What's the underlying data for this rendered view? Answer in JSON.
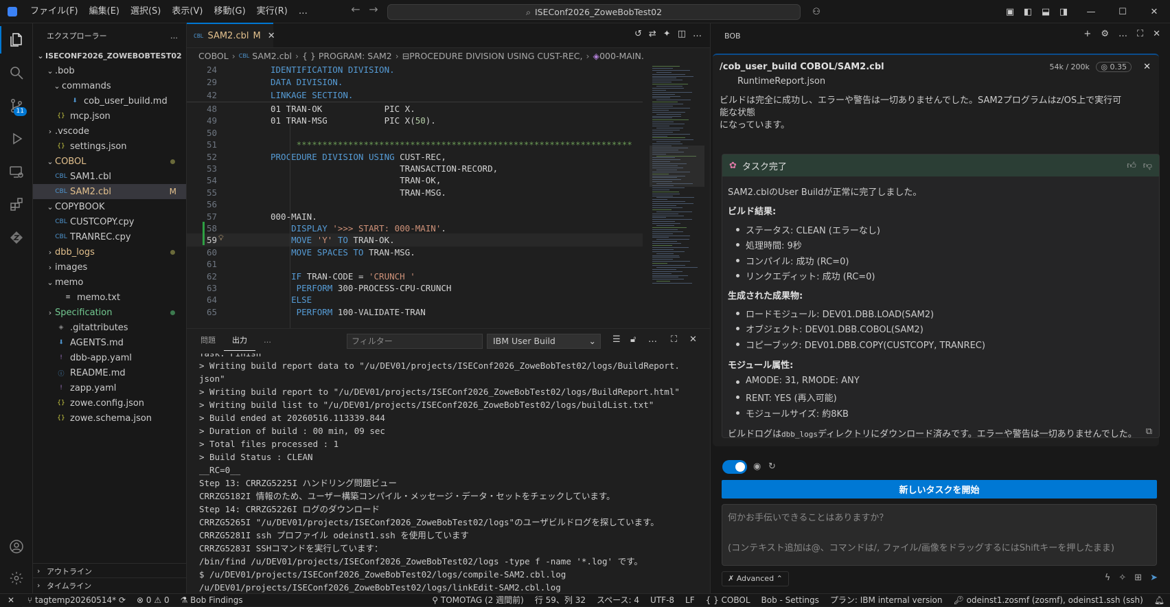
{
  "window": {
    "search_text": "ISEConf2026_ZoweBobTest02"
  },
  "menu": [
    "ファイル(F)",
    "編集(E)",
    "選択(S)",
    "表示(V)",
    "移動(G)",
    "実行(R)",
    "…"
  ],
  "activity_bar": {
    "scm_badge": "11"
  },
  "sidebar": {
    "title": "エクスプローラー",
    "more": "…",
    "root": "ISECONF2026_ZOWEBOBTEST02",
    "items": [
      {
        "label": ".bob",
        "chev": "⌄",
        "indent": 1,
        "icon": "",
        "color": "#cccccc"
      },
      {
        "label": "commands",
        "chev": "⌄",
        "indent": 2,
        "icon": "",
        "color": "#cccccc"
      },
      {
        "label": "cob_user_build.md",
        "chev": "",
        "indent": 3,
        "icon": "⬇",
        "icon_color": "#4e94ce",
        "color": "#cccccc"
      },
      {
        "label": "mcp.json",
        "chev": "",
        "indent": 1,
        "icon": "{}",
        "icon_color": "#cbcb41",
        "color": "#cccccc"
      },
      {
        "label": ".vscode",
        "chev": "›",
        "indent": 1,
        "icon": "",
        "color": "#cccccc"
      },
      {
        "label": "settings.json",
        "chev": "",
        "indent": 1,
        "icon": "{}",
        "icon_color": "#cbcb41",
        "color": "#cccccc"
      },
      {
        "label": "COBOL",
        "chev": "⌄",
        "indent": 1,
        "icon": "",
        "color": "#e2c08d",
        "dot": "#6a6a3a"
      },
      {
        "label": "SAM1.cbl",
        "chev": "",
        "indent": 1,
        "icon": "CBL",
        "icon_color": "#4e94ce",
        "color": "#cccccc"
      },
      {
        "label": "SAM2.cbl",
        "chev": "",
        "indent": 1,
        "icon": "CBL",
        "icon_color": "#4e94ce",
        "color": "#e2c08d",
        "mark": "M",
        "selected": true
      },
      {
        "label": "COPYBOOK",
        "chev": "⌄",
        "indent": 1,
        "icon": "",
        "color": "#cccccc"
      },
      {
        "label": "CUSTCOPY.cpy",
        "chev": "",
        "indent": 1,
        "icon": "CBL",
        "icon_color": "#4e94ce",
        "color": "#cccccc"
      },
      {
        "label": "TRANREC.cpy",
        "chev": "",
        "indent": 1,
        "icon": "CBL",
        "icon_color": "#4e94ce",
        "color": "#cccccc"
      },
      {
        "label": "dbb_logs",
        "chev": "›",
        "indent": 1,
        "icon": "",
        "color": "#e2c08d",
        "dot": "#6a6a3a"
      },
      {
        "label": "images",
        "chev": "›",
        "indent": 1,
        "icon": "",
        "color": "#cccccc"
      },
      {
        "label": "memo",
        "chev": "⌄",
        "indent": 1,
        "icon": "",
        "color": "#cccccc"
      },
      {
        "label": "memo.txt",
        "chev": "",
        "indent": 2,
        "icon": "≡",
        "icon_color": "#cccccc",
        "color": "#cccccc"
      },
      {
        "label": "Specification",
        "chev": "›",
        "indent": 1,
        "icon": "",
        "color": "#73c991",
        "dot": "#3c7a4e"
      },
      {
        "label": ".gitattributes",
        "chev": "",
        "indent": 1,
        "icon": "◈",
        "icon_color": "#8a8a8a",
        "color": "#cccccc"
      },
      {
        "label": "AGENTS.md",
        "chev": "",
        "indent": 1,
        "icon": "⬇",
        "icon_color": "#4e94ce",
        "color": "#cccccc"
      },
      {
        "label": "dbb-app.yaml",
        "chev": "",
        "indent": 1,
        "icon": "!",
        "icon_color": "#a074c4",
        "color": "#cccccc"
      },
      {
        "label": "README.md",
        "chev": "",
        "indent": 1,
        "icon": "ⓘ",
        "icon_color": "#4e94ce",
        "color": "#cccccc"
      },
      {
        "label": "zapp.yaml",
        "chev": "",
        "indent": 1,
        "icon": "!",
        "icon_color": "#a074c4",
        "color": "#cccccc"
      },
      {
        "label": "zowe.config.json",
        "chev": "",
        "indent": 1,
        "icon": "{}",
        "icon_color": "#cbcb41",
        "color": "#cccccc"
      },
      {
        "label": "zowe.schema.json",
        "chev": "",
        "indent": 1,
        "icon": "{}",
        "icon_color": "#cbcb41",
        "color": "#cccccc"
      }
    ],
    "outline": "アウトライン",
    "timeline": "タイムライン"
  },
  "editor": {
    "tab": {
      "badge": "CBL",
      "name": "SAM2.cbl",
      "modified": "M",
      "close": "✕"
    },
    "breadcrumb": [
      "COBOL",
      "SAM2.cbl",
      "{ } PROGRAM: SAM2",
      "PROCEDURE DIVISION USING CUST-REC,",
      "000-MAIN."
    ],
    "sticky_lines": [
      {
        "n": "24",
        "parts": [
          {
            "t": "IDENTIFICATION DIVISION.",
            "c": "kw"
          }
        ]
      },
      {
        "n": "29",
        "parts": [
          {
            "t": "DATA DIVISION.",
            "c": "kw"
          }
        ]
      },
      {
        "n": "42",
        "parts": [
          {
            "t": "LINKAGE SECTION.",
            "c": "kw"
          }
        ]
      }
    ],
    "lines": [
      {
        "n": "48",
        "parts": [
          {
            "t": "01 TRAN-OK            PIC X.",
            "c": "id"
          }
        ]
      },
      {
        "n": "49",
        "parts": [
          {
            "t": "01 TRAN-MSG           PIC X(",
            "c": "id"
          },
          {
            "t": "50",
            "c": "num"
          },
          {
            "t": ").",
            "c": "id"
          }
        ]
      },
      {
        "n": "50",
        "parts": []
      },
      {
        "n": "51",
        "parts": [
          {
            "t": "*****************************************************************",
            "c": "cm"
          }
        ],
        "indent": "     "
      },
      {
        "n": "52",
        "parts": [
          {
            "t": "PROCEDURE DIVISION USING ",
            "c": "kw"
          },
          {
            "t": "CUST-REC,",
            "c": "id"
          }
        ]
      },
      {
        "n": "53",
        "parts": [
          {
            "t": "                         TRANSACTION-RECORD,",
            "c": "id"
          }
        ]
      },
      {
        "n": "54",
        "parts": [
          {
            "t": "                         TRAN-OK,",
            "c": "id"
          }
        ]
      },
      {
        "n": "55",
        "parts": [
          {
            "t": "                         TRAN-MSG.",
            "c": "id"
          }
        ]
      },
      {
        "n": "56",
        "parts": []
      },
      {
        "n": "57",
        "parts": [
          {
            "t": "000-MAIN.",
            "c": "id"
          }
        ]
      },
      {
        "n": "58",
        "parts": [
          {
            "t": "    DISPLAY ",
            "c": "kw"
          },
          {
            "t": "'>>> START: 000-MAIN'",
            "c": "str"
          },
          {
            "t": ".",
            "c": "id"
          }
        ]
      },
      {
        "n": "59",
        "parts": [
          {
            "t": "    MOVE ",
            "c": "kw"
          },
          {
            "t": "'Y'",
            "c": "str"
          },
          {
            "t": " TO ",
            "c": "kw"
          },
          {
            "t": "TRAN-OK.",
            "c": "id"
          }
        ],
        "current": true
      },
      {
        "n": "60",
        "parts": [
          {
            "t": "    MOVE SPACES TO ",
            "c": "kw"
          },
          {
            "t": "TRAN-MSG.",
            "c": "id"
          }
        ]
      },
      {
        "n": "61",
        "parts": []
      },
      {
        "n": "62",
        "parts": [
          {
            "t": "    IF ",
            "c": "kw"
          },
          {
            "t": "TRAN-CODE = ",
            "c": "id"
          },
          {
            "t": "'CRUNCH '",
            "c": "str"
          }
        ]
      },
      {
        "n": "63",
        "parts": [
          {
            "t": "     PERFORM ",
            "c": "kw"
          },
          {
            "t": "300-PROCESS-CPU-CRUNCH",
            "c": "id"
          }
        ]
      },
      {
        "n": "64",
        "parts": [
          {
            "t": "    ELSE",
            "c": "kw"
          }
        ]
      },
      {
        "n": "65",
        "parts": [
          {
            "t": "     PERFORM ",
            "c": "kw"
          },
          {
            "t": "100-VALIDATE-TRAN",
            "c": "id"
          }
        ]
      }
    ]
  },
  "panel": {
    "tab_problems": "問題",
    "tab_output": "出力",
    "more": "…",
    "filter_placeholder": "フィルター",
    "channel": "IBM User Build",
    "output_lines": [
      "Task: Finish",
      "> Writing build report data to \"/u/DEV01/projects/ISEConf2026_ZoweBobTest02/logs/BuildReport.",
      "json\"",
      "> Writing build report to \"/u/DEV01/projects/ISEConf2026_ZoweBobTest02/logs/BuildReport.html\"",
      "> Writing build list to \"/u/DEV01/projects/ISEConf2026_ZoweBobTest02/logs/buildList.txt\"",
      "> Build ended at 20260516.113339.844",
      "> Duration of build : 00 min, 09 sec",
      "> Total files processed : 1",
      "> Build Status : CLEAN",
      "__RC=0__",
      "Step 13: CRRZG5225I ハンドリング問題ビュー",
      "CRRZG5182I 情報のため、ユーザー構築コンパイル・メッセージ・データ・セットをチェックしています。",
      "Step 14: CRRZG5226I ログのダウンロード",
      "CRRZG5265I \"/u/DEV01/projects/ISEConf2026_ZoweBobTest02/logs\"のユーザビルドログを探しています。",
      "CRRZG5281I ssh プロファイル odeinst1.ssh を使用しています",
      "CRRZG5283I SSHコマンドを実行しています：",
      "/bin/find /u/DEV01/projects/ISEConf2026_ZoweBobTest02/logs -type f -name '*.log' です。",
      "$ /u/DEV01/projects/ISEConf2026_ZoweBobTest02/logs/compile-SAM2.cbl.log",
      "/u/DEV01/projects/ISEConf2026_ZoweBobTest02/logs/linkEdit-SAM2.cbl.log"
    ]
  },
  "bob": {
    "title": "BOB",
    "task_title": "/cob_user_build COBOL/SAM2.cbl",
    "tokens": "54k / 200k",
    "cost": "0.35",
    "partial_item": "RuntimeReport.json",
    "summary": "ビルドは完全に成功し、エラーや警告は一切ありませんでした。SAM2プログラムはz/OS上で実行可能な状態になっています。",
    "summary_line1": "ビルドは完全に成功し、エラーや警告は一切ありませんでした。SAM2プログラムはz/OS上で実行可能な状態",
    "summary_line2": "になっています。",
    "task_complete": "タスク完了",
    "intro": "SAM2.cblのUser Buildが正常に完了しました。",
    "h_result": "ビルド結果:",
    "result_items": [
      "ステータス: CLEAN (エラーなし)",
      "処理時間: 9秒",
      "コンパイル: 成功 (RC=0)",
      "リンクエディット: 成功 (RC=0)"
    ],
    "h_artifacts": "生成された成果物:",
    "artifact_items": [
      "ロードモジュール: DEV01.DBB.LOAD(SAM2)",
      "オブジェクト: DEV01.DBB.COBOL(SAM2)",
      "コピーブック: DEV01.DBB.COPY(CUSTCOPY, TRANREC)"
    ],
    "h_attrs": "モジュール属性:",
    "attr_items": [
      "AMODE: 31, RMODE: ANY",
      "RENT: YES (再入可能)",
      "モジュールサイズ: 約8KB"
    ],
    "footer_pre": "ビルドログは",
    "footer_code": "dbb_logs",
    "footer_post": "ディレクトリにダウンロード済みです。エラーや警告は一切ありませんでした。",
    "new_task": "新しいタスクを開始",
    "chat_placeholder_1": "何かお手伝いできることはありますか？",
    "chat_placeholder_2": "(コンテキスト追加は@、コマンドは/, ファイル/画像をドラッグするにはShiftキーを押したまま)",
    "advanced": "Advanced"
  },
  "statusbar": {
    "branch": "tagtemp20260514*",
    "errors": "0",
    "warnings": "0",
    "findings": "Bob Findings",
    "tomotag": "TOMOTAG (2 週間前)",
    "position": "行 59、列 32",
    "spaces": "スペース: 4",
    "encoding": "UTF-8",
    "eol": "LF",
    "language": "COBOL",
    "bob_settings": "Bob - Settings",
    "plan": "プラン: IBM internal version",
    "ssh": "odeinst1.zosmf (zosmf), odeinst1.ssh (ssh)"
  }
}
